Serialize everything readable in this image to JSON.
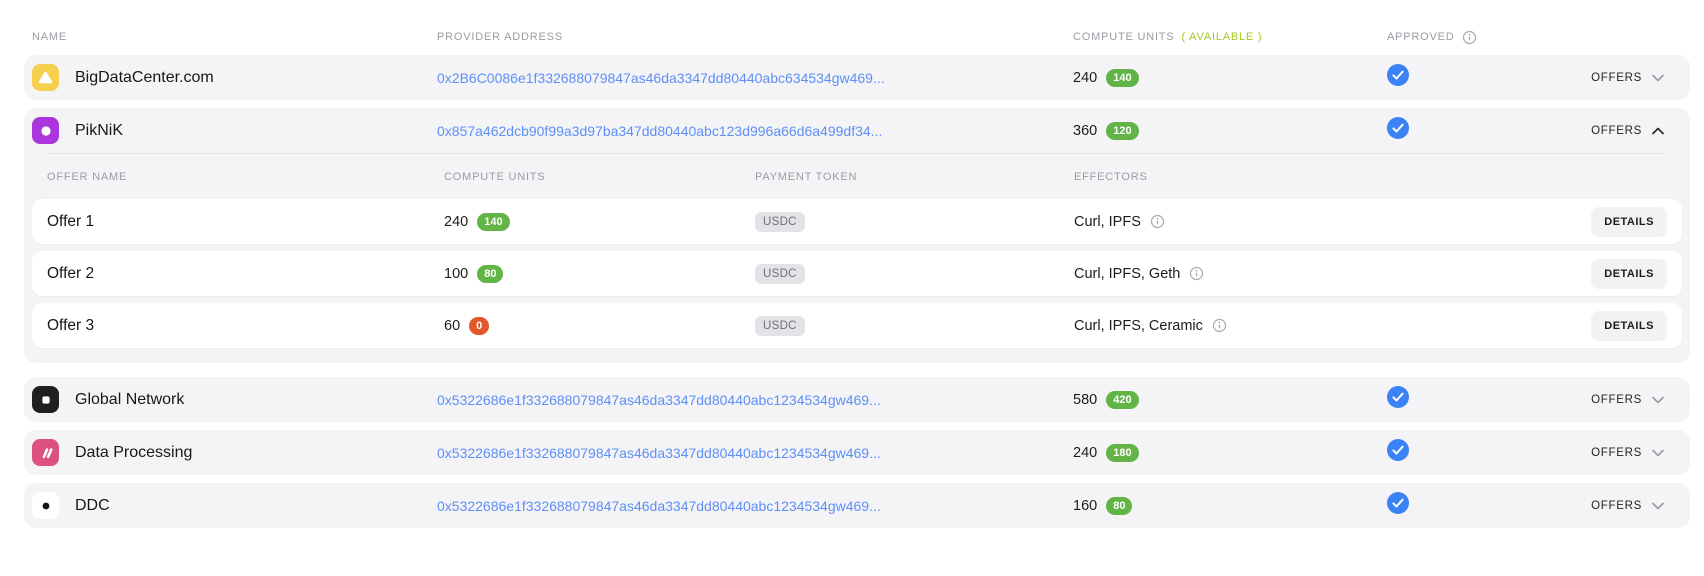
{
  "header": {
    "name": "NAME",
    "provider_address": "PROVIDER ADDRESS",
    "compute_units": "COMPUTE UNITS",
    "available": "( AVAILABLE )",
    "approved": "APPROVED"
  },
  "offers_header": {
    "offer_name": "OFFER NAME",
    "compute_units": "COMPUTE UNITS",
    "payment_token": "PAYMENT TOKEN",
    "effectors": "EFFECTORS"
  },
  "labels": {
    "offers": "OFFERS",
    "details": "DETAILS"
  },
  "providers": [
    {
      "name": "BigDataCenter.com",
      "icon": "triangle-yellow-icon",
      "address": "0x2B6C0086e1f332688079847as46da3347dd80440abc634534gw469...",
      "compute_units": "240",
      "available": "140",
      "approved": true,
      "expanded": false
    },
    {
      "name": "PikNiK",
      "icon": "circle-purple-icon",
      "address": "0x857a462dcb90f99a3d97ba347dd80440abc123d996a66d6a499df34...",
      "compute_units": "360",
      "available": "120",
      "approved": true,
      "expanded": true,
      "offers": [
        {
          "name": "Offer 1",
          "compute_units": "240",
          "available": "140",
          "payment_token": "USDC",
          "effectors": "Curl, IPFS"
        },
        {
          "name": "Offer 2",
          "compute_units": "100",
          "available": "80",
          "payment_token": "USDC",
          "effectors": "Curl, IPFS, Geth"
        },
        {
          "name": "Offer 3",
          "compute_units": "60",
          "available": "0",
          "payment_token": "USDC",
          "effectors": "Curl, IPFS, Ceramic"
        }
      ]
    },
    {
      "name": "Global Network",
      "icon": "square-black-icon",
      "address": "0x5322686e1f332688079847as46da3347dd80440abc1234534gw469...",
      "compute_units": "580",
      "available": "420",
      "approved": true,
      "expanded": false
    },
    {
      "name": "Data Processing",
      "icon": "slashes-pink-icon",
      "address": "0x5322686e1f332688079847as46da3347dd80440abc1234534gw469...",
      "compute_units": "240",
      "available": "180",
      "approved": true,
      "expanded": false
    },
    {
      "name": "DDC",
      "icon": "dot-white-icon",
      "address": "0x5322686e1f332688079847as46da3347dd80440abc1234534gw469...",
      "compute_units": "160",
      "available": "80",
      "approved": true,
      "expanded": false
    }
  ],
  "colors": {
    "available_green": "#A2CA21",
    "badge_green": "#62B446",
    "badge_red": "#E2572B",
    "approved_blue": "#3B82F6",
    "link_blue": "#5E8FF5",
    "row_bg": "#F4F4F6",
    "logo_yellow": "#F6CF4F",
    "logo_purple": "#AB36DD",
    "logo_black": "#202023",
    "logo_pink": "#DC5180"
  }
}
